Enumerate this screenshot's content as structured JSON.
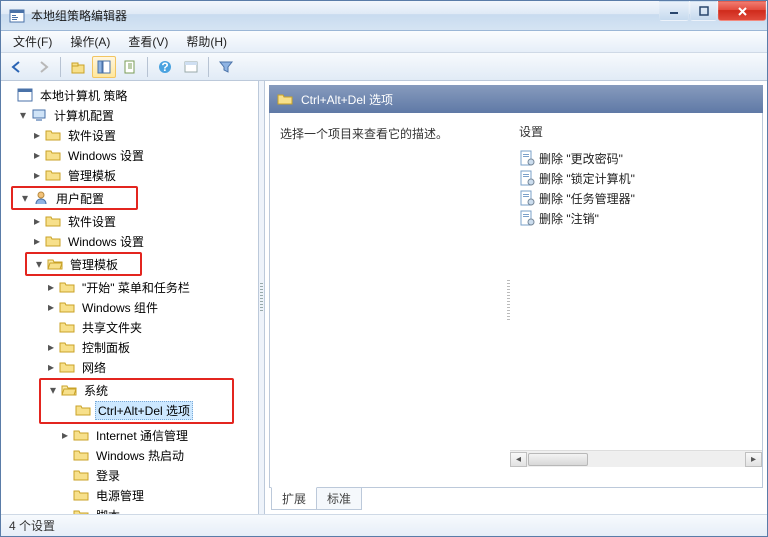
{
  "window": {
    "title": "本地组策略编辑器"
  },
  "menu": {
    "file": "文件(F)",
    "action": "操作(A)",
    "view": "查看(V)",
    "help": "帮助(H)"
  },
  "tree": {
    "root": "本地计算机 策略",
    "computer": "计算机配置",
    "cc_soft": "软件设置",
    "cc_win": "Windows 设置",
    "cc_admin": "管理模板",
    "user": "用户配置",
    "uc_soft": "软件设置",
    "uc_win": "Windows 设置",
    "uc_admin": "管理模板",
    "start_taskbar": "\"开始\" 菜单和任务栏",
    "win_comp": "Windows 组件",
    "share": "共享文件夹",
    "ctrl_panel": "控制面板",
    "network": "网络",
    "system": "系统",
    "cad": "Ctrl+Alt+Del 选项",
    "inet": "Internet 通信管理",
    "hotstart": "Windows 热启动",
    "logon": "登录",
    "power": "电源管理",
    "script": "脚本"
  },
  "content": {
    "header": "Ctrl+Alt+Del 选项",
    "prompt": "选择一个项目来查看它的描述。",
    "settings_header": "设置",
    "items": [
      "删除 \"更改密码\"",
      "删除 \"锁定计算机\"",
      "删除 \"任务管理器\"",
      "删除 \"注销\""
    ]
  },
  "tabs": {
    "extended": "扩展",
    "standard": "标准"
  },
  "status": "4 个设置"
}
